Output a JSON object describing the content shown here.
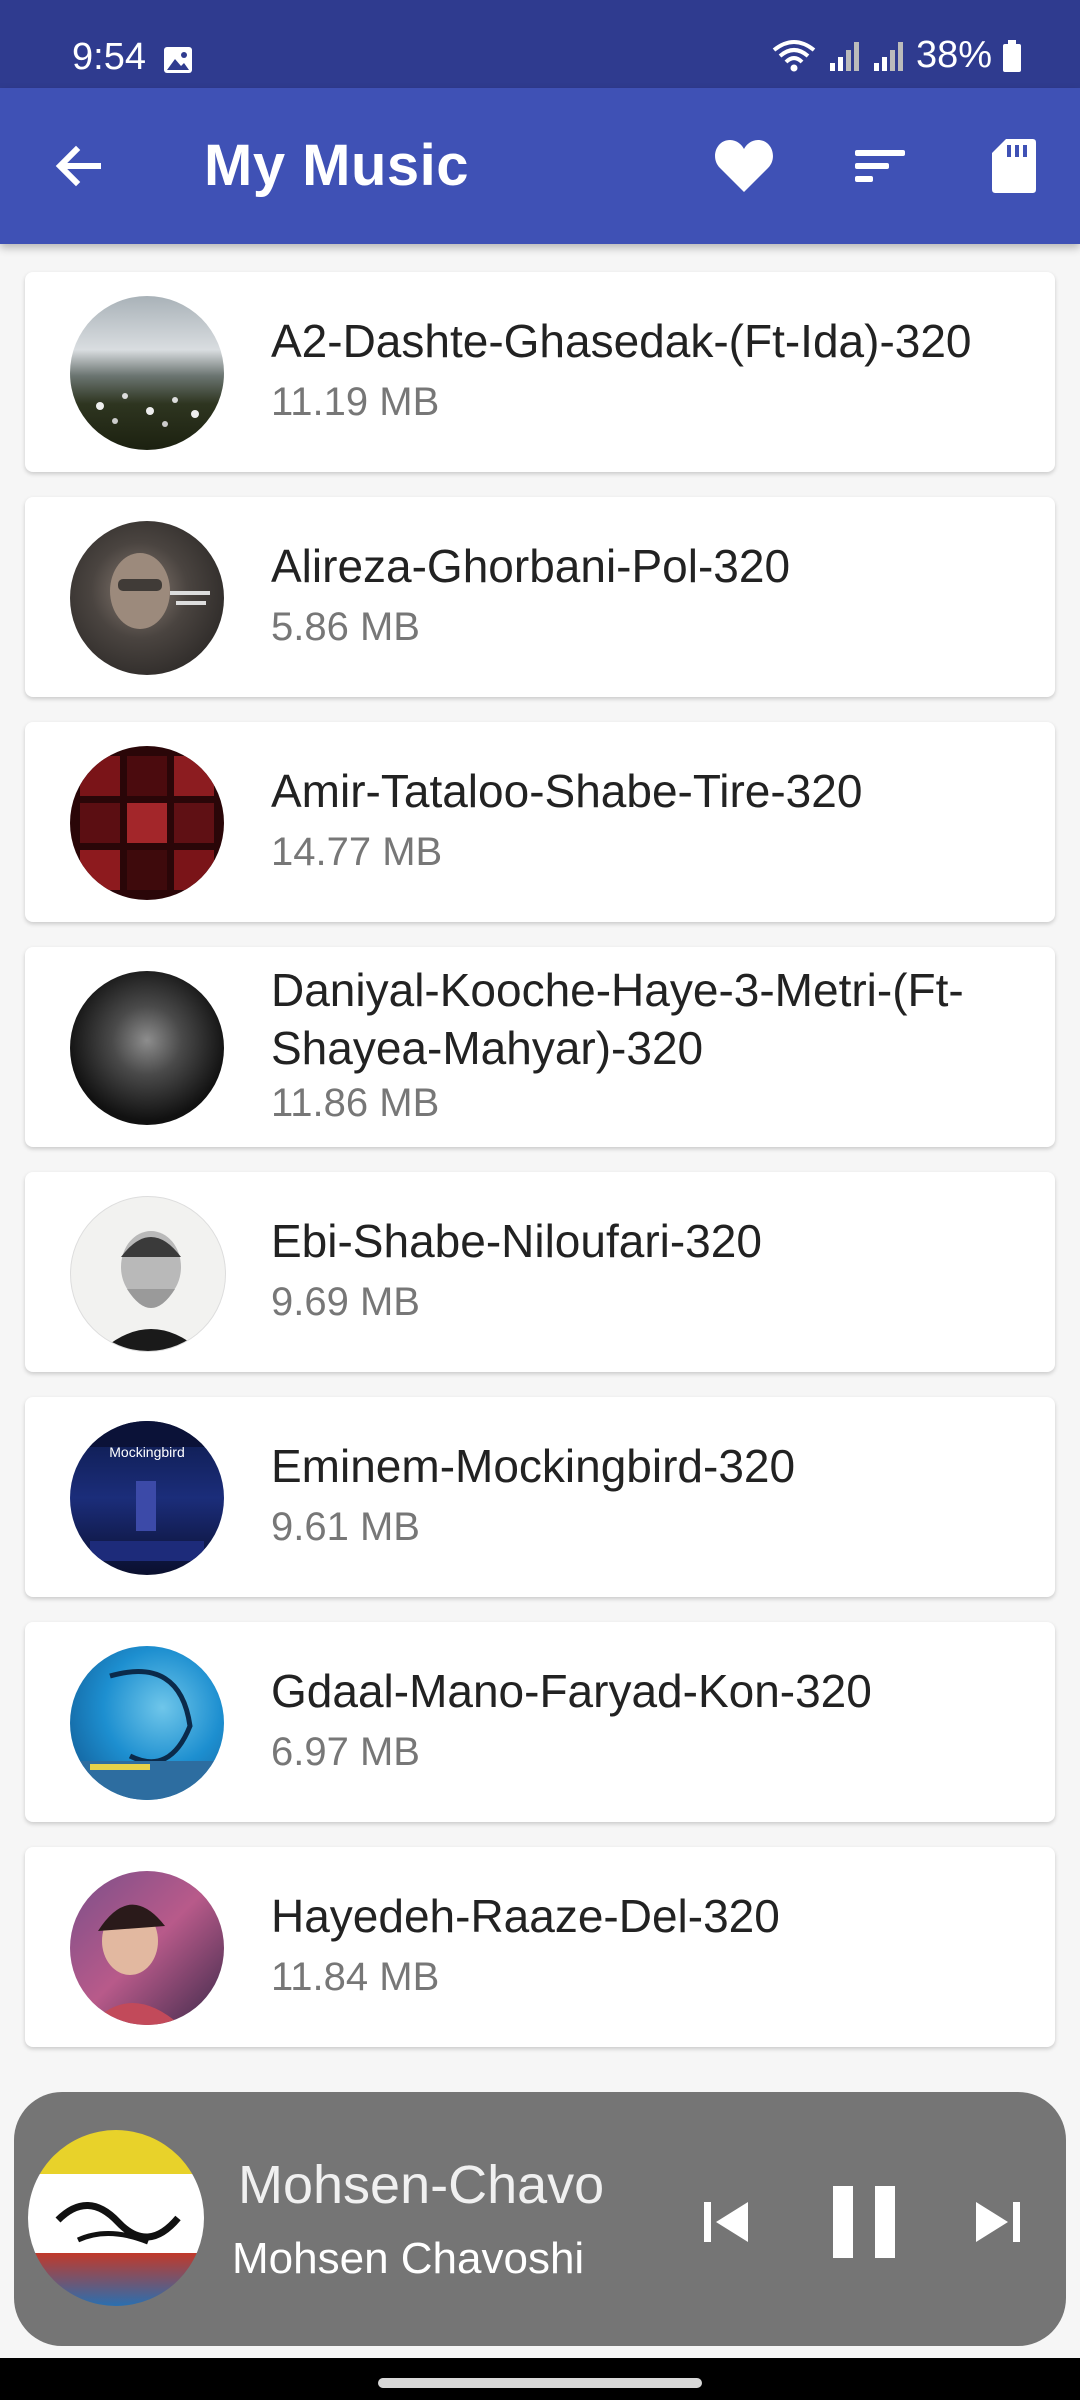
{
  "status_bar": {
    "time": "9:54",
    "battery": "38%"
  },
  "app_bar": {
    "title": "My Music",
    "icons": [
      "back-arrow-icon",
      "heart-icon",
      "sort-icon",
      "sd-card-icon"
    ],
    "background": "#3f51b5"
  },
  "songs": [
    {
      "title": "A2-Dashte-Ghasedak-(Ft-Ida)-320",
      "size": "11.19 MB"
    },
    {
      "title": "Alireza-Ghorbani-Pol-320",
      "size": "5.86 MB"
    },
    {
      "title": "Amir-Tataloo-Shabe-Tire-320",
      "size": "14.77 MB"
    },
    {
      "title": "Daniyal-Kooche-Haye-3-Metri-(Ft-Shayea-Mahyar)-320",
      "size": "11.86 MB"
    },
    {
      "title": "Ebi-Shabe-Niloufari-320",
      "size": "9.69 MB"
    },
    {
      "title": "Eminem-Mockingbird-320",
      "size": "9.61 MB"
    },
    {
      "title": "Gdaal-Mano-Faryad-Kon-320",
      "size": "6.97 MB"
    },
    {
      "title": "Hayedeh-Raaze-Del-320",
      "size": "11.84 MB"
    }
  ],
  "player": {
    "title": "Mohsen-Chavo",
    "artist": "Mohsen Chavoshi",
    "state": "playing",
    "background": "#757575"
  }
}
